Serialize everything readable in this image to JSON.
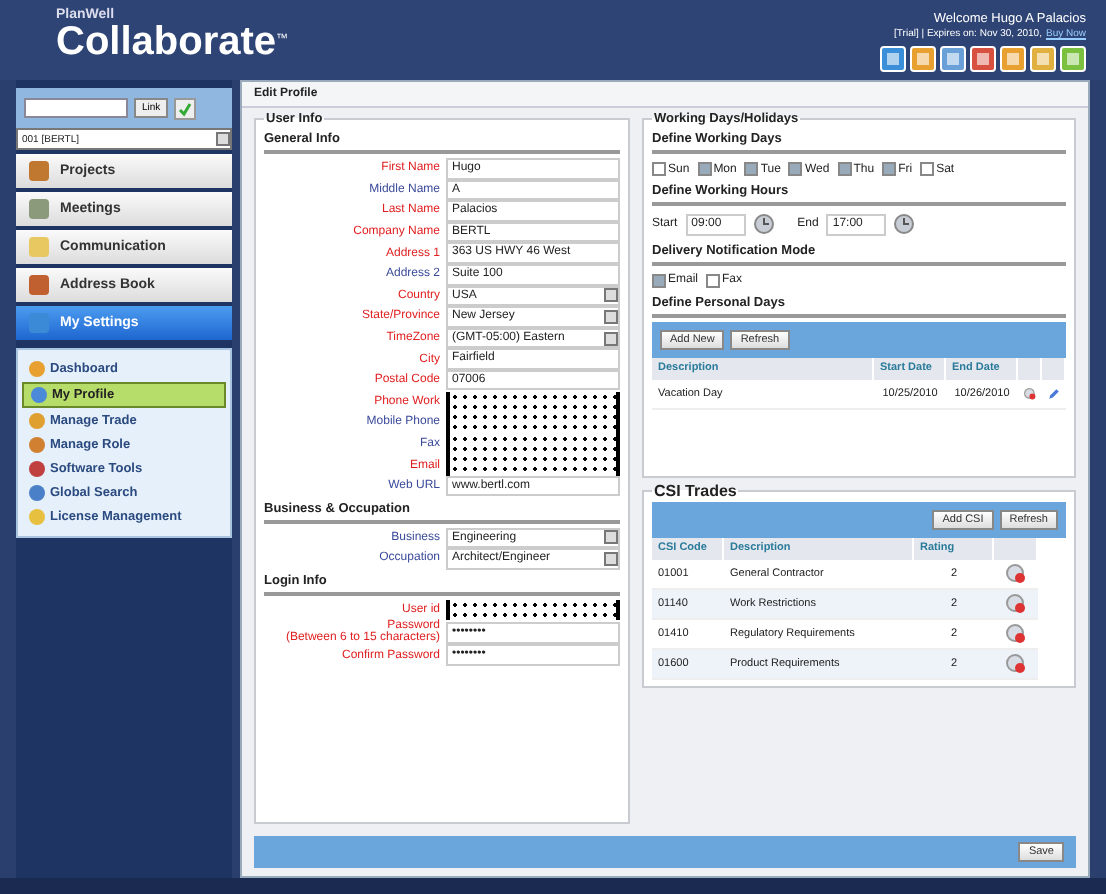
{
  "header": {
    "brand_small": "PlanWell",
    "brand": "Collaborate",
    "trademark": "™",
    "welcome": "Welcome Hugo A Palacios",
    "subscription": "[Trial] | Expires on: Nov 30, 2010,",
    "buy": "Buy Now"
  },
  "sidebar": {
    "go_button": "Link",
    "project_select": "001 [BERTL]",
    "nav": [
      {
        "label": "Projects",
        "selected": false
      },
      {
        "label": "Meetings",
        "selected": false
      },
      {
        "label": "Communication",
        "selected": false
      },
      {
        "label": "Address Book",
        "selected": false
      },
      {
        "label": "My Settings",
        "selected": true
      }
    ],
    "sub_nav": [
      {
        "label": "Dashboard",
        "selected": false
      },
      {
        "label": "My Profile",
        "selected": true
      },
      {
        "label": "Manage Trade",
        "selected": false
      },
      {
        "label": "Manage Role",
        "selected": false
      },
      {
        "label": "Software Tools",
        "selected": false
      },
      {
        "label": "Global Search",
        "selected": false
      },
      {
        "label": "License Management",
        "selected": false
      }
    ]
  },
  "page_title": "Edit Profile",
  "user_info": {
    "legend": "User Info",
    "sections": [
      {
        "title": "General Info",
        "fields": [
          {
            "label": "First Name",
            "required": true,
            "kind": "text",
            "value": "Hugo"
          },
          {
            "label": "Middle Name",
            "required": false,
            "kind": "text",
            "value": "A"
          },
          {
            "label": "Last Name",
            "required": true,
            "kind": "text",
            "value": "Palacios"
          },
          {
            "label": "Company Name",
            "required": true,
            "kind": "text",
            "value": "BERTL"
          },
          {
            "label": "Address 1",
            "required": true,
            "kind": "text",
            "value": "363 US HWY 46 West"
          },
          {
            "label": "Address 2",
            "required": false,
            "kind": "text",
            "value": "Suite 100"
          },
          {
            "label": "Country",
            "required": true,
            "kind": "select",
            "value": "USA"
          },
          {
            "label": "State/Province",
            "required": true,
            "kind": "select",
            "value": "New Jersey"
          },
          {
            "label": "TimeZone",
            "required": true,
            "kind": "select",
            "value": "(GMT-05:00) Eastern"
          },
          {
            "label": "City",
            "required": true,
            "kind": "text",
            "value": "Fairfield"
          },
          {
            "label": "Postal Code",
            "required": true,
            "kind": "text",
            "value": "07006"
          },
          {
            "label": "Phone Work",
            "required": true,
            "kind": "redacted"
          },
          {
            "label": "Mobile Phone",
            "required": false,
            "kind": "redacted"
          },
          {
            "label": "Fax",
            "required": false,
            "kind": "redacted"
          },
          {
            "label": "Email",
            "required": true,
            "kind": "redacted"
          },
          {
            "label": "Web URL",
            "required": false,
            "kind": "text",
            "value": "www.bertl.com"
          }
        ]
      },
      {
        "title": "Business & Occupation",
        "fields": [
          {
            "label": "Business",
            "required": false,
            "kind": "select",
            "value": "Engineering"
          },
          {
            "label": "Occupation",
            "required": false,
            "kind": "select",
            "value": "Architect/Engineer"
          }
        ]
      },
      {
        "title": "Login Info",
        "fields": [
          {
            "label": "User id",
            "required": true,
            "kind": "redacted"
          },
          {
            "label": "Password",
            "note": "(Between 6 to 15 characters)",
            "required": true,
            "kind": "password",
            "value": "••••••••"
          },
          {
            "label": "Confirm Password",
            "required": true,
            "kind": "password",
            "value": "••••••••"
          }
        ]
      }
    ]
  },
  "working_days": {
    "legend": "Working Days/Holidays",
    "days_title": "Define Working Days",
    "days": [
      {
        "label": "Sun",
        "checked": false
      },
      {
        "label": "Mon",
        "checked": true
      },
      {
        "label": "Tue",
        "checked": true
      },
      {
        "label": "Wed",
        "checked": true
      },
      {
        "label": "Thu",
        "checked": true
      },
      {
        "label": "Fri",
        "checked": true
      },
      {
        "label": "Sat",
        "checked": false
      }
    ],
    "hours_title": "Define Working Hours",
    "start_label": "Start",
    "start": "09:00",
    "end_label": "End",
    "end": "17:00",
    "notify_title": "Delivery Notification Mode",
    "notify": [
      {
        "label": "Email",
        "checked": true
      },
      {
        "label": "Fax",
        "checked": false
      }
    ],
    "personal_title": "Define Personal Days",
    "buttons": [
      "Add New",
      "Refresh"
    ],
    "columns": [
      "Description",
      "Start Date",
      "End Date"
    ],
    "rows": [
      {
        "description": "Vacation Day",
        "start": "10/25/2010",
        "end": "10/26/2010"
      }
    ]
  },
  "csi": {
    "legend": "CSI Trades",
    "buttons": [
      "Add CSI",
      "Refresh"
    ],
    "columns": [
      "CSI Code",
      "Description",
      "Rating"
    ],
    "rows": [
      {
        "code": "01001",
        "description": "General Contractor",
        "rating": "2"
      },
      {
        "code": "01140",
        "description": "Work Restrictions",
        "rating": "2"
      },
      {
        "code": "01410",
        "description": "Regulatory Requirements",
        "rating": "2"
      },
      {
        "code": "01600",
        "description": "Product Requirements",
        "rating": "2"
      }
    ]
  },
  "save": "Save"
}
